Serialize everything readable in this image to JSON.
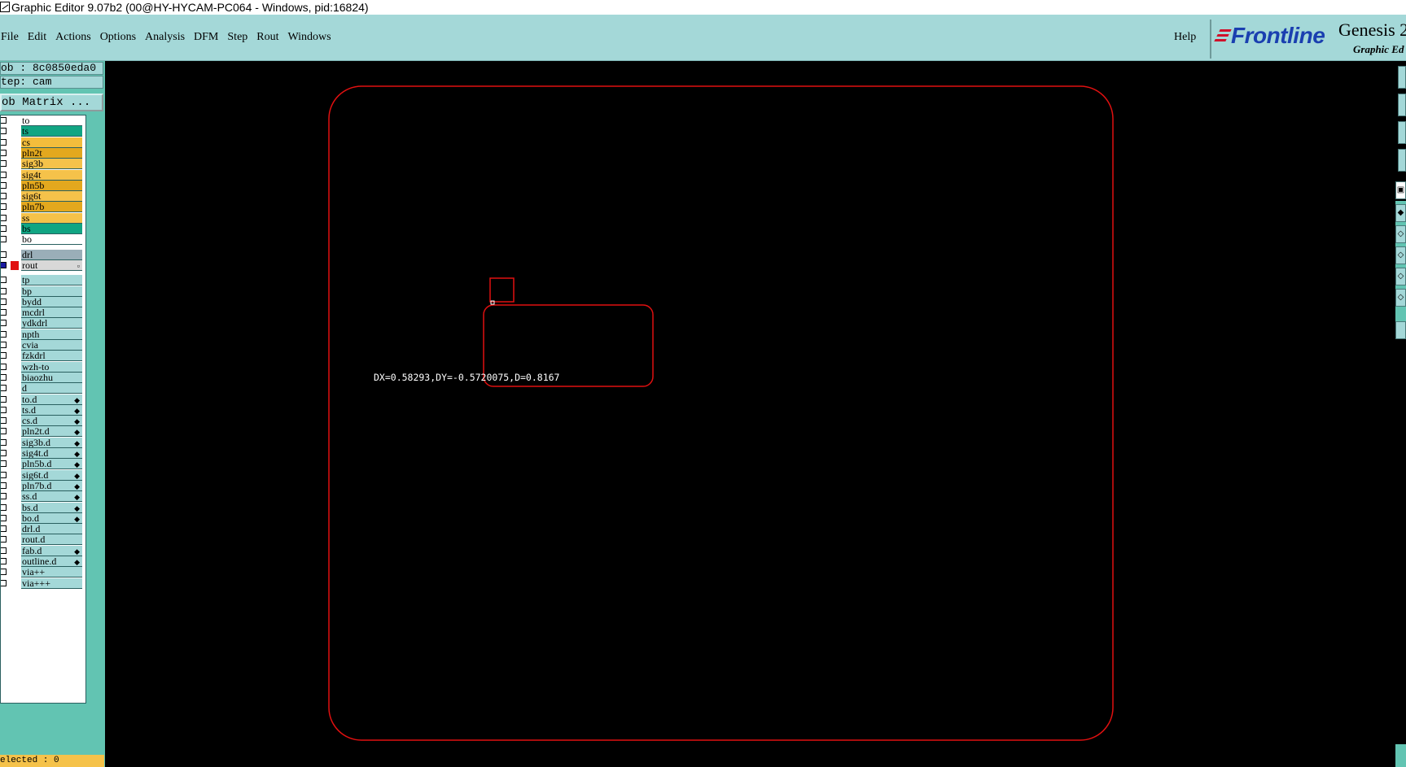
{
  "window": {
    "title": "Graphic Editor 9.07b2 (00@HY-HYCAM-PC064 - Windows, pid:16824)"
  },
  "menu": {
    "items": [
      {
        "label": "File",
        "underline": "F",
        "rest": "ile"
      },
      {
        "label": "Edit",
        "underline": "E",
        "rest": "dit"
      },
      {
        "label": "Actions",
        "underline": "A",
        "rest": "ctions"
      },
      {
        "label": "Options",
        "underline": "O",
        "rest": "ptions"
      },
      {
        "label": "Analysis",
        "underline": "A",
        "rest": "nalysis"
      },
      {
        "label": "DFM",
        "underline": "",
        "rest": "DFM"
      },
      {
        "label": "Step",
        "underline": "S",
        "rest": "tep"
      },
      {
        "label": "Rout",
        "underline": "R",
        "rest": "out"
      },
      {
        "label": "Windows",
        "underline": "W",
        "rest": "indows"
      }
    ],
    "help": "Help"
  },
  "brand": {
    "logo": "Frontline",
    "product": "Genesis 2",
    "product_sub": "Graphic Ed"
  },
  "job": {
    "job_line": "ob : 8c0850eda0",
    "step_line": "tep: cam",
    "matrix_button": "ob Matrix ..."
  },
  "layers": [
    {
      "name": "to",
      "color": "#ffffff",
      "sub": ""
    },
    {
      "name": "ts",
      "color": "#11a583",
      "sub": ""
    },
    {
      "name": "cs",
      "color": "#f3bd3c",
      "sub": ""
    },
    {
      "name": "pln2t",
      "color": "#e3a81e",
      "sub": ""
    },
    {
      "name": "sig3b",
      "color": "#f5c24a",
      "sub": ""
    },
    {
      "name": "sig4t",
      "color": "#f5c24a",
      "sub": ""
    },
    {
      "name": "pln5b",
      "color": "#e3a81e",
      "sub": ""
    },
    {
      "name": "sig6t",
      "color": "#f5c24a",
      "sub": ""
    },
    {
      "name": "pln7b",
      "color": "#e3a81e",
      "sub": ""
    },
    {
      "name": "ss",
      "color": "#f5c24a",
      "sub": ""
    },
    {
      "name": "bs",
      "color": "#11a583",
      "sub": ""
    },
    {
      "name": "bo",
      "color": "#ffffff",
      "sub": ""
    },
    {
      "name": "drl",
      "color": "#9aaeb8",
      "sub": ""
    },
    {
      "name": "rout",
      "color": "#d8d8d8",
      "sub": "▫"
    },
    {
      "name": "tp",
      "color": "#a4d8d8",
      "sub": ""
    },
    {
      "name": "bp",
      "color": "#a4d8d8",
      "sub": ""
    },
    {
      "name": "bydd",
      "color": "#a4d8d8",
      "sub": ""
    },
    {
      "name": "mcdrl",
      "color": "#a4d8d8",
      "sub": ""
    },
    {
      "name": "ydkdrl",
      "color": "#a4d8d8",
      "sub": ""
    },
    {
      "name": "npth",
      "color": "#a4d8d8",
      "sub": ""
    },
    {
      "name": "cvia",
      "color": "#a4d8d8",
      "sub": ""
    },
    {
      "name": "fzkdrl",
      "color": "#a4d8d8",
      "sub": ""
    },
    {
      "name": "wzh-to",
      "color": "#a4d8d8",
      "sub": ""
    },
    {
      "name": "biaozhu",
      "color": "#a4d8d8",
      "sub": ""
    },
    {
      "name": "d",
      "color": "#a4d8d8",
      "sub": ""
    },
    {
      "name": "to.d",
      "color": "#a4d8d8",
      "sub": "◆"
    },
    {
      "name": "ts.d",
      "color": "#a4d8d8",
      "sub": "◆"
    },
    {
      "name": "cs.d",
      "color": "#a4d8d8",
      "sub": "◆"
    },
    {
      "name": "pln2t.d",
      "color": "#a4d8d8",
      "sub": "◆"
    },
    {
      "name": "sig3b.d",
      "color": "#a4d8d8",
      "sub": "◆"
    },
    {
      "name": "sig4t.d",
      "color": "#a4d8d8",
      "sub": "◆"
    },
    {
      "name": "pln5b.d",
      "color": "#a4d8d8",
      "sub": "◆"
    },
    {
      "name": "sig6t.d",
      "color": "#a4d8d8",
      "sub": "◆"
    },
    {
      "name": "pln7b.d",
      "color": "#a4d8d8",
      "sub": "◆"
    },
    {
      "name": "ss.d",
      "color": "#a4d8d8",
      "sub": "◆"
    },
    {
      "name": "bs.d",
      "color": "#a4d8d8",
      "sub": "◆"
    },
    {
      "name": "bo.d",
      "color": "#a4d8d8",
      "sub": "◆"
    },
    {
      "name": "drl.d",
      "color": "#a4d8d8",
      "sub": ""
    },
    {
      "name": "rout.d",
      "color": "#a4d8d8",
      "sub": ""
    },
    {
      "name": "fab.d",
      "color": "#a4d8d8",
      "sub": "◆"
    },
    {
      "name": "outline.d",
      "color": "#a4d8d8",
      "sub": "◆"
    },
    {
      "name": "via++",
      "color": "#a4d8d8",
      "sub": ""
    },
    {
      "name": "via+++",
      "color": "#a4d8d8",
      "sub": ""
    }
  ],
  "status": {
    "selected": "elected : 0"
  },
  "canvas": {
    "measure": "DX=0.58293,DY=-0.5720075,D=0.8167",
    "outline_color": "#e01010"
  },
  "colors": {
    "panel_bg": "#a4d8d8",
    "panel_dark": "#62c4b2",
    "canvas_bg": "#000000"
  }
}
